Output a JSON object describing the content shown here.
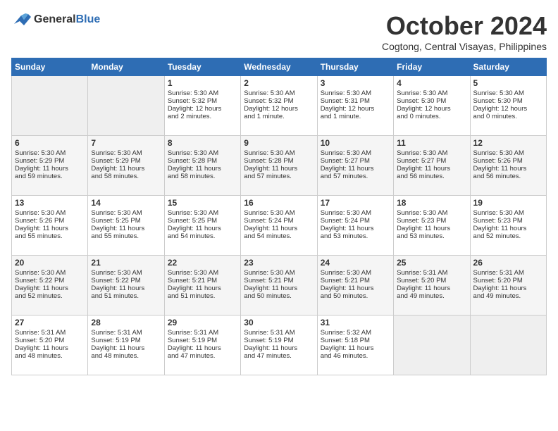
{
  "header": {
    "logo_line1": "General",
    "logo_line2": "Blue",
    "month": "October 2024",
    "location": "Cogtong, Central Visayas, Philippines"
  },
  "days_of_week": [
    "Sunday",
    "Monday",
    "Tuesday",
    "Wednesday",
    "Thursday",
    "Friday",
    "Saturday"
  ],
  "weeks": [
    [
      {
        "day": "",
        "info": ""
      },
      {
        "day": "",
        "info": ""
      },
      {
        "day": "1",
        "info": "Sunrise: 5:30 AM\nSunset: 5:32 PM\nDaylight: 12 hours\nand 2 minutes."
      },
      {
        "day": "2",
        "info": "Sunrise: 5:30 AM\nSunset: 5:32 PM\nDaylight: 12 hours\nand 1 minute."
      },
      {
        "day": "3",
        "info": "Sunrise: 5:30 AM\nSunset: 5:31 PM\nDaylight: 12 hours\nand 1 minute."
      },
      {
        "day": "4",
        "info": "Sunrise: 5:30 AM\nSunset: 5:30 PM\nDaylight: 12 hours\nand 0 minutes."
      },
      {
        "day": "5",
        "info": "Sunrise: 5:30 AM\nSunset: 5:30 PM\nDaylight: 12 hours\nand 0 minutes."
      }
    ],
    [
      {
        "day": "6",
        "info": "Sunrise: 5:30 AM\nSunset: 5:29 PM\nDaylight: 11 hours\nand 59 minutes."
      },
      {
        "day": "7",
        "info": "Sunrise: 5:30 AM\nSunset: 5:29 PM\nDaylight: 11 hours\nand 58 minutes."
      },
      {
        "day": "8",
        "info": "Sunrise: 5:30 AM\nSunset: 5:28 PM\nDaylight: 11 hours\nand 58 minutes."
      },
      {
        "day": "9",
        "info": "Sunrise: 5:30 AM\nSunset: 5:28 PM\nDaylight: 11 hours\nand 57 minutes."
      },
      {
        "day": "10",
        "info": "Sunrise: 5:30 AM\nSunset: 5:27 PM\nDaylight: 11 hours\nand 57 minutes."
      },
      {
        "day": "11",
        "info": "Sunrise: 5:30 AM\nSunset: 5:27 PM\nDaylight: 11 hours\nand 56 minutes."
      },
      {
        "day": "12",
        "info": "Sunrise: 5:30 AM\nSunset: 5:26 PM\nDaylight: 11 hours\nand 56 minutes."
      }
    ],
    [
      {
        "day": "13",
        "info": "Sunrise: 5:30 AM\nSunset: 5:26 PM\nDaylight: 11 hours\nand 55 minutes."
      },
      {
        "day": "14",
        "info": "Sunrise: 5:30 AM\nSunset: 5:25 PM\nDaylight: 11 hours\nand 55 minutes."
      },
      {
        "day": "15",
        "info": "Sunrise: 5:30 AM\nSunset: 5:25 PM\nDaylight: 11 hours\nand 54 minutes."
      },
      {
        "day": "16",
        "info": "Sunrise: 5:30 AM\nSunset: 5:24 PM\nDaylight: 11 hours\nand 54 minutes."
      },
      {
        "day": "17",
        "info": "Sunrise: 5:30 AM\nSunset: 5:24 PM\nDaylight: 11 hours\nand 53 minutes."
      },
      {
        "day": "18",
        "info": "Sunrise: 5:30 AM\nSunset: 5:23 PM\nDaylight: 11 hours\nand 53 minutes."
      },
      {
        "day": "19",
        "info": "Sunrise: 5:30 AM\nSunset: 5:23 PM\nDaylight: 11 hours\nand 52 minutes."
      }
    ],
    [
      {
        "day": "20",
        "info": "Sunrise: 5:30 AM\nSunset: 5:22 PM\nDaylight: 11 hours\nand 52 minutes."
      },
      {
        "day": "21",
        "info": "Sunrise: 5:30 AM\nSunset: 5:22 PM\nDaylight: 11 hours\nand 51 minutes."
      },
      {
        "day": "22",
        "info": "Sunrise: 5:30 AM\nSunset: 5:21 PM\nDaylight: 11 hours\nand 51 minutes."
      },
      {
        "day": "23",
        "info": "Sunrise: 5:30 AM\nSunset: 5:21 PM\nDaylight: 11 hours\nand 50 minutes."
      },
      {
        "day": "24",
        "info": "Sunrise: 5:30 AM\nSunset: 5:21 PM\nDaylight: 11 hours\nand 50 minutes."
      },
      {
        "day": "25",
        "info": "Sunrise: 5:31 AM\nSunset: 5:20 PM\nDaylight: 11 hours\nand 49 minutes."
      },
      {
        "day": "26",
        "info": "Sunrise: 5:31 AM\nSunset: 5:20 PM\nDaylight: 11 hours\nand 49 minutes."
      }
    ],
    [
      {
        "day": "27",
        "info": "Sunrise: 5:31 AM\nSunset: 5:20 PM\nDaylight: 11 hours\nand 48 minutes."
      },
      {
        "day": "28",
        "info": "Sunrise: 5:31 AM\nSunset: 5:19 PM\nDaylight: 11 hours\nand 48 minutes."
      },
      {
        "day": "29",
        "info": "Sunrise: 5:31 AM\nSunset: 5:19 PM\nDaylight: 11 hours\nand 47 minutes."
      },
      {
        "day": "30",
        "info": "Sunrise: 5:31 AM\nSunset: 5:19 PM\nDaylight: 11 hours\nand 47 minutes."
      },
      {
        "day": "31",
        "info": "Sunrise: 5:32 AM\nSunset: 5:18 PM\nDaylight: 11 hours\nand 46 minutes."
      },
      {
        "day": "",
        "info": ""
      },
      {
        "day": "",
        "info": ""
      }
    ]
  ]
}
